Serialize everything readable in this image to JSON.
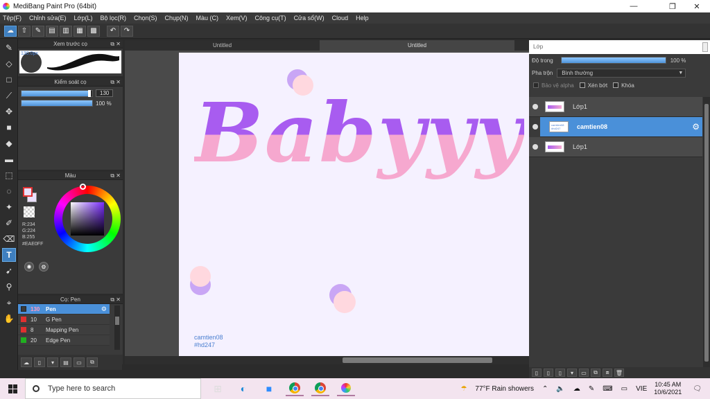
{
  "window": {
    "title": "MediBang Paint Pro (64bit)",
    "controls": {
      "minimize": "—",
      "maximize": "❐",
      "close": "✕"
    }
  },
  "menu": [
    "Tệp(F)",
    "Chỉnh sửa(E)",
    "Lớp(L)",
    "Bộ lọc(R)",
    "Chọn(S)",
    "Chụp(N)",
    "Màu (C)",
    "Xem(V)",
    "Công cụ(T)",
    "Cửa sổ(W)",
    "Cloud",
    "Help"
  ],
  "toolbar": {
    "icons": [
      "cloud-icon",
      "upload-icon",
      "comment-icon",
      "layers-icon",
      "document-icon",
      "grid-icon",
      "palette-icon"
    ],
    "undo_icon": "↶",
    "redo_icon": "↷"
  },
  "tools": [
    "brush-icon",
    "eraser-icon",
    "rectangle-icon",
    "curve-icon",
    "move-icon",
    "fill-rect-icon",
    "bucket-icon",
    "gradient-icon",
    "select-rect-icon",
    "lasso-icon",
    "magic-wand-icon",
    "select-pen-icon",
    "select-eraser-icon",
    "text-icon",
    "operation-icon",
    "dropper-icon",
    "dropper2-icon",
    "hand-icon"
  ],
  "brush_preview": {
    "title": "Xem trước cọ",
    "size_label": "130.0px"
  },
  "brush_control": {
    "title": "Kiểm soát cọ",
    "size": 130,
    "size_fraction": 0.96,
    "opacity": "100 %",
    "opacity_fraction": 1.0
  },
  "color": {
    "title": "Màu",
    "r": "R:234",
    "g": "G:224",
    "b": "B:255",
    "hex": "#EAE0FF",
    "fg": "#EAE0FF",
    "accent": "#E03030"
  },
  "brush_list": {
    "title": "Cọ: Pen",
    "items": [
      {
        "size": "130",
        "name": "Pen",
        "color": "#3A3A3A"
      },
      {
        "size": "10",
        "name": "G Pen",
        "color": "#E03030"
      },
      {
        "size": "8",
        "name": "Mapping Pen",
        "color": "#E03030"
      },
      {
        "size": "20",
        "name": "Edge Pen",
        "color": "#20B020"
      }
    ]
  },
  "canvas": {
    "tabs": [
      "Untitled",
      "Untitled"
    ],
    "text": "Babyyy",
    "signature_line1": "camtien08",
    "signature_line2": "#hd247",
    "purple": "#A85CF0",
    "pink": "#F6A8CF"
  },
  "layers": {
    "title": "Lớp",
    "opacity_label": "Độ trong",
    "opacity_value": "100 %",
    "blend_label": "Pha trộn",
    "blend_value": "Bình thường",
    "checks": [
      "Bảo vệ alpha",
      "Xén bớt",
      "Khóa"
    ],
    "items": [
      {
        "name": "Lớp1",
        "selected": false
      },
      {
        "name": "camtien08",
        "selected": true,
        "thumb": "camtien08 #hd247"
      },
      {
        "name": "Lớp1",
        "selected": false
      }
    ]
  },
  "taskbar": {
    "search_placeholder": "Type here to search",
    "weather": "77°F  Rain showers",
    "lang": "VIE",
    "time": "10:45 AM",
    "date": "10/6/2021"
  }
}
